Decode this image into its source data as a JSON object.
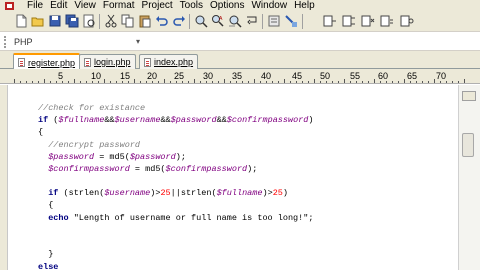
{
  "menu": [
    "File",
    "Edit",
    "View",
    "Format",
    "Project",
    "Tools",
    "Options",
    "Window",
    "Help"
  ],
  "language": {
    "value": "PHP"
  },
  "tabs": [
    {
      "label": "register.php",
      "active": true
    },
    {
      "label": "login.php",
      "active": false
    },
    {
      "label": "index.php",
      "active": false
    }
  ],
  "ruler": {
    "numbers": [
      "5",
      "10",
      "15",
      "20",
      "25",
      "30",
      "35",
      "40",
      "45",
      "50",
      "55",
      "60",
      "65",
      "70"
    ]
  },
  "toolbar_icons": [
    "new-file-icon",
    "open-folder-icon",
    "save-icon",
    "save-all-icon",
    "print-preview-icon",
    "cut-icon",
    "copy-icon",
    "paste-icon",
    "undo-icon",
    "redo-icon",
    "find-icon",
    "find-replace-icon",
    "find-in-files-icon",
    "wrap-icon",
    "tools-icon",
    "bookmark-icon",
    "bookmark-next-icon",
    "bookmark-prev-icon",
    "bookmark-clear-icon"
  ],
  "code": {
    "l1": "//check for existance",
    "l2a": "if",
    "l2b": " (",
    "l2c": "$fullname",
    "l2d": "&&",
    "l2e": "$username",
    "l2f": "&&",
    "l2g": "$password",
    "l2h": "&&",
    "l2i": "$confirmpassword",
    "l2j": ")",
    "l3": "{",
    "l4": "  //encrypt password",
    "l5a": "  $password",
    "l5b": " = md5(",
    "l5c": "$password",
    "l5d": ");",
    "l6a": "  $confirmpassword",
    "l6b": " = md5(",
    "l6c": "$confirmpassword",
    "l6d": ");",
    "l7a": "  if",
    "l7b": " (strlen(",
    "l7c": "$username",
    "l7d": ")>",
    "l7e": "25",
    "l7f": "||strlen(",
    "l7g": "$fullname",
    "l7h": ")>",
    "l7i": "25",
    "l7j": ")",
    "l8": "  {",
    "l9a": "  echo",
    "l9b": " \"Length of username or full name is too long!\";",
    "l10": "  }",
    "l11": "else"
  }
}
